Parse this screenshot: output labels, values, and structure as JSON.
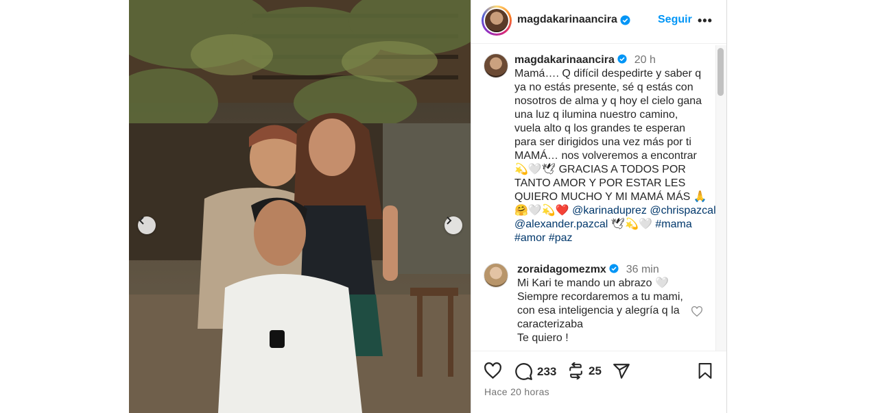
{
  "post": {
    "photo_alt": "Foto del post",
    "nav_prev_icon": "chevron-left-icon",
    "nav_next_icon": "chevron-right-icon"
  },
  "header": {
    "username": "magdakarinaancira",
    "follow_label": "Seguir",
    "more_label": "•••"
  },
  "caption": {
    "username": "magdakarinaancira",
    "time": "20 h",
    "lines": [
      "Mamá…. Q difícil despedirte y saber q",
      "ya no estás presente, sé q estás con",
      "nosotros de alma y q hoy el cielo gana",
      "una luz q ilumina nuestro camino,",
      "vuela alto q los grandes te esperan",
      "para ser dirigidos una vez más por ti",
      "MAMÁ… nos volveremos a encontrar",
      "💫🤍🕊 GRACIAS A TODOS POR",
      "TANTO AMOR Y POR ESTAR LES",
      "QUIERO MUCHO Y MI MAMÁ MÁS 🙏"
    ],
    "line10_prefix": "🤗🤍💫❤️",
    "mention1": "@karinaduprez",
    "mention2": "@chrispazcal",
    "mention3": "@alexander.pazcal",
    "line11_emojis": "🕊💫🤍",
    "hashtag1": "#mama",
    "hashtag2": "#amor",
    "hashtag3": "#paz"
  },
  "comment": {
    "username": "zoraidagomezmx",
    "time": "36 min",
    "lines": [
      "Mi Kari te mando un abrazo 🤍",
      "Siempre recordaremos a tu mami,",
      "con esa inteligencia y alegría q la",
      "caracterizaba",
      "Te quiero !"
    ]
  },
  "actions": {
    "comments_count": "233",
    "reposts_count": "25",
    "posted_ago": "Hace 20 horas"
  },
  "colors": {
    "link": "#0095f6",
    "mention": "#00376b",
    "verified": "#0095f6"
  }
}
